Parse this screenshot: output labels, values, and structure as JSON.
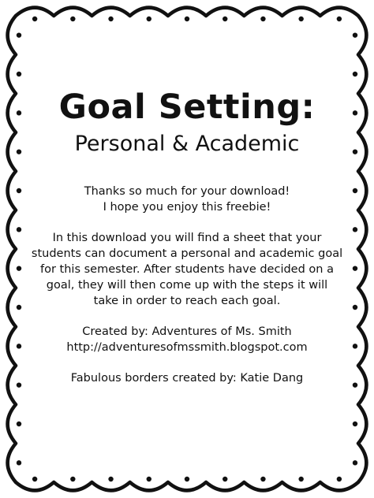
{
  "page": {
    "title": "Goal Setting:",
    "subtitle": "Personal & Academic",
    "thanks": [
      "Thanks so much for your download!",
      "I hope you enjoy this freebie!"
    ],
    "description": [
      "In this download you will find a sheet that your",
      "students can document a personal and academic goal",
      "for this semester. After students have decided on a",
      "goal, they will then come up with the steps it will",
      "take in order to reach each goal."
    ],
    "credits": [
      "Created by: Adventures of Ms. Smith",
      "http://adventuresofmssmith.blogspot.com"
    ],
    "borders_credit": "Fabulous borders created by: Katie Dang"
  },
  "colors": {
    "border": "#111111",
    "background": "#ffffff",
    "text": "#111111"
  }
}
